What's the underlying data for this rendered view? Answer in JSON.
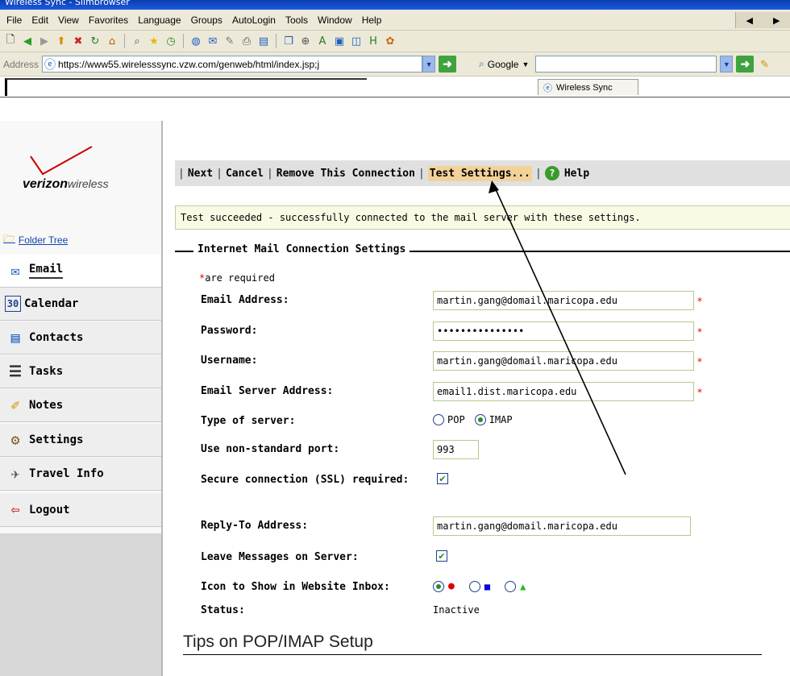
{
  "window": {
    "title": "Wireless Sync - Slimbrowser"
  },
  "menu": [
    "File",
    "Edit",
    "View",
    "Favorites",
    "Language",
    "Groups",
    "AutoLogin",
    "Tools",
    "Window",
    "Help"
  ],
  "address_bar": {
    "label": "Address",
    "url": "https://www55.wirelesssync.vzw.com/genweb/html/index.jsp;j",
    "search_engine": "Google"
  },
  "tab": {
    "label": "Wireless Sync"
  },
  "brand": {
    "name_bold": "verizon",
    "name_light": "wireless",
    "accent": "#cc0000"
  },
  "sidebar": {
    "folder_tree": "Folder Tree",
    "items": [
      {
        "label": "Email",
        "icon": "email-icon"
      },
      {
        "label": "Calendar",
        "icon": "calendar-icon"
      },
      {
        "label": "Contacts",
        "icon": "contacts-icon"
      },
      {
        "label": "Tasks",
        "icon": "tasks-icon"
      },
      {
        "label": "Notes",
        "icon": "notes-icon"
      },
      {
        "label": "Settings",
        "icon": "settings-icon"
      },
      {
        "label": "Travel Info",
        "icon": "travel-icon"
      },
      {
        "label": "Logout",
        "icon": "logout-icon"
      }
    ]
  },
  "actions": {
    "next": "Next",
    "cancel": "Cancel",
    "remove": "Remove This Connection",
    "test": "Test Settings...",
    "help": "Help"
  },
  "message": "Test succeeded - successfully connected to the mail server with these settings.",
  "form": {
    "legend": "Internet Mail Connection Settings",
    "required_star": "*",
    "required_note": "are required",
    "email_label": "Email Address:",
    "email_value": "martin.gang@domail.maricopa.edu",
    "password_label": "Password:",
    "password_value": "•••••••••••••••",
    "username_label": "Username:",
    "username_value": "martin.gang@domail.maricopa.edu",
    "server_label": "Email Server Address:",
    "server_value": "email1.dist.maricopa.edu",
    "type_label": "Type of server:",
    "type_options": [
      "POP",
      "IMAP"
    ],
    "type_selected": "IMAP",
    "port_label": "Use non-standard port:",
    "port_value": "993",
    "ssl_label": "Secure connection (SSL) required:",
    "ssl_checked": true,
    "reply_label": "Reply-To Address:",
    "reply_value": "martin.gang@domail.maricopa.edu",
    "leave_label": "Leave Messages on Server:",
    "leave_checked": true,
    "icon_label": "Icon to Show in Website Inbox:",
    "icon_options": [
      {
        "shape": "●",
        "color": "#e00000"
      },
      {
        "shape": "■",
        "color": "#0000dd"
      },
      {
        "shape": "▲",
        "color": "#22bb22"
      }
    ],
    "status_label": "Status:",
    "status_value": "Inactive"
  },
  "tips_heading": "Tips on POP/IMAP Setup"
}
